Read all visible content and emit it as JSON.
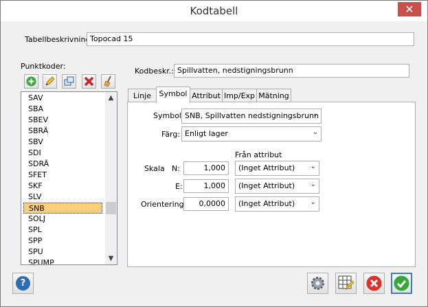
{
  "window": {
    "title": "Kodtabell",
    "close_glyph": "✕"
  },
  "table": {
    "label": "Tabellbeskrivning:",
    "value": "Topocad 15"
  },
  "codes": {
    "label": "Punktkoder:",
    "toolbar": [
      "add-icon",
      "edit-icon",
      "copy-icon",
      "delete-icon",
      "broom-icon"
    ],
    "items": [
      "SAV",
      "SBA",
      "SBEV",
      "SBRÄ",
      "SBV",
      "SDI",
      "SDRÄ",
      "SFET",
      "SKF",
      "SLV",
      "SNB",
      "SOLJ",
      "SPL",
      "SPP",
      "SPU",
      "SPUMP"
    ],
    "selected": "SNB"
  },
  "detail": {
    "label": "Kodbeskr.:",
    "value": "Spillvatten, nedstigningsbrunn"
  },
  "tabs": [
    "Linje",
    "Symbol",
    "Attribut",
    "Imp/Exp",
    "Mätning"
  ],
  "active_tab": "Symbol",
  "symbol": {
    "symbol_label": "Symbol:",
    "symbol_value": "SNB, Spillvatten nedstigningsbrunn",
    "farg_label": "Färg:",
    "farg_value": "Enligt lager",
    "fran_label": "Från attribut",
    "skala_label": "Skala",
    "n_label": "N:",
    "n_value": "1,000",
    "n_attr": "(Inget Attribut)",
    "e_label": "E:",
    "e_value": "1,000",
    "e_attr": "(Inget Attribut)",
    "or_label": "Orientering:",
    "or_value": "0,0000",
    "or_attr": "(Inget Attribut)"
  },
  "footer": {
    "help": "?",
    "buttons": [
      "settings-icon",
      "grid-edit-icon",
      "cancel-icon",
      "ok-icon"
    ]
  },
  "colors": {
    "accent": "#3c7fb1",
    "selection": "#fcd07a",
    "close": "#c7504a"
  }
}
